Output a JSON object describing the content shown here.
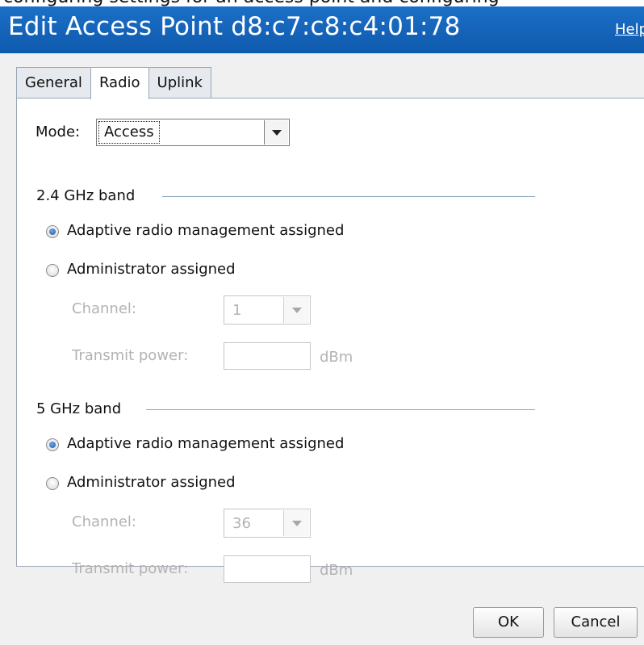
{
  "window": {
    "title": "Edit Access Point d8:c7:c8:c4:01:78",
    "help_label": "Help",
    "prev_line_text": "configuring settings for an access point and configuring"
  },
  "tabs": [
    {
      "label": "General",
      "active": false
    },
    {
      "label": "Radio",
      "active": true
    },
    {
      "label": "Uplink",
      "active": false
    }
  ],
  "mode": {
    "label": "Mode:",
    "value": "Access"
  },
  "bands": [
    {
      "header": "2.4 GHz band",
      "adaptive_label": "Adaptive radio management assigned",
      "admin_label": "Administrator assigned",
      "selected": "adaptive",
      "channel_label": "Channel:",
      "channel_value": "1",
      "power_label": "Transmit power:",
      "power_value": "",
      "power_unit": "dBm"
    },
    {
      "header": "5 GHz band",
      "adaptive_label": "Adaptive radio management assigned",
      "admin_label": "Administrator assigned",
      "selected": "adaptive",
      "channel_label": "Channel:",
      "channel_value": "36",
      "power_label": "Transmit power:",
      "power_value": "",
      "power_unit": "dBm"
    }
  ],
  "buttons": {
    "ok_label": "OK",
    "cancel_label": "Cancel"
  },
  "colors": {
    "titlebar": "#1465bb",
    "radio_selected": "#1d5aa6",
    "group_line": "#8ea5bd"
  }
}
